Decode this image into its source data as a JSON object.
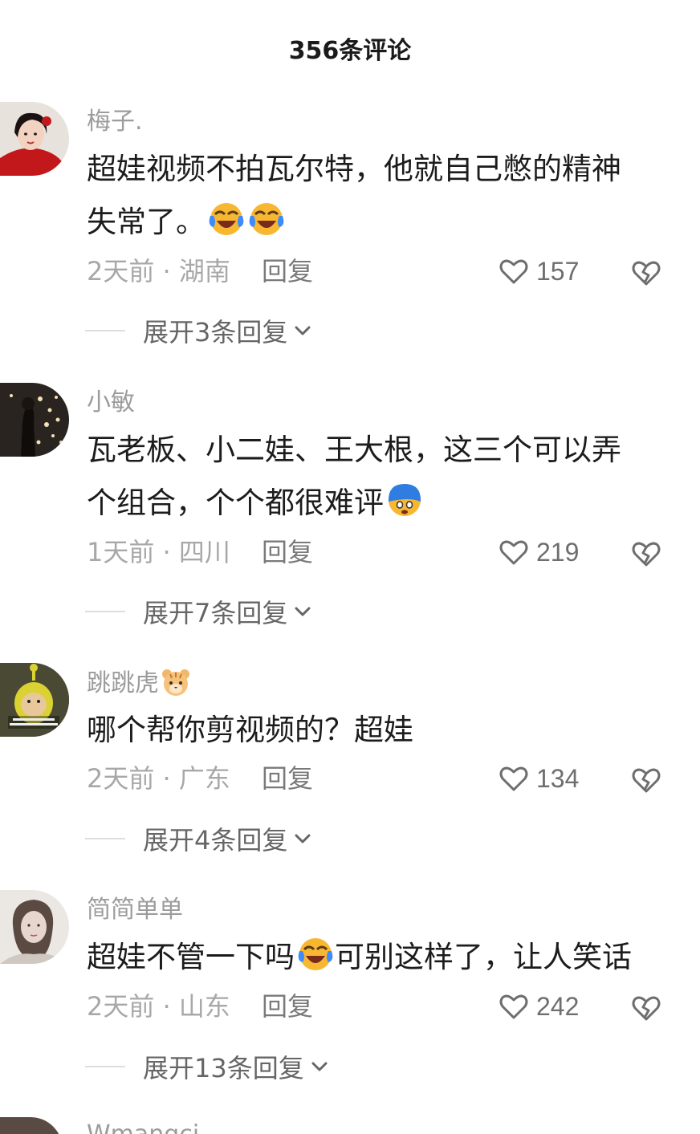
{
  "header": {
    "title": "356条评论"
  },
  "comments": [
    {
      "username": "梅子.",
      "text": "超娃视频不拍瓦尔特，他就自己憋的精神失常了。",
      "emojis": [
        "laugh-cry-emoji",
        "laugh-cry-emoji"
      ],
      "time_location": "2天前 · 湖南",
      "reply_label": "回复",
      "likes": "157",
      "expand_label": "展开3条回复"
    },
    {
      "username": "小敏",
      "text": "瓦老板、小二娃、王大根，这三个可以弄个组合，个个都很难评",
      "emojis": [
        "shocked-blue-emoji"
      ],
      "time_location": "1天前 · 四川",
      "reply_label": "回复",
      "likes": "219",
      "expand_label": "展开7条回复"
    },
    {
      "username": "跳跳虎",
      "username_emoji": "tiger-emoji",
      "text": "哪个帮你剪视频的？超娃",
      "emojis": [],
      "time_location": "2天前 · 广东",
      "reply_label": "回复",
      "likes": "134",
      "expand_label": "展开4条回复"
    },
    {
      "username": "简简单单",
      "text_before": "超娃不管一下吗",
      "text_after": "可别这样了，让人笑话",
      "emojis": [
        "laugh-cry-emoji"
      ],
      "time_location": "2天前 · 山东",
      "reply_label": "回复",
      "likes": "242",
      "expand_label": "展开13条回复"
    }
  ],
  "partial_next": {
    "username": "Wmangçi"
  },
  "colors": {
    "username": "#9c9c9c",
    "body": "#1c1c1c",
    "meta": "#a8a8a8",
    "accent_emoji_face": "#f7b731",
    "accent_emoji_tears": "#3d8bfd"
  }
}
